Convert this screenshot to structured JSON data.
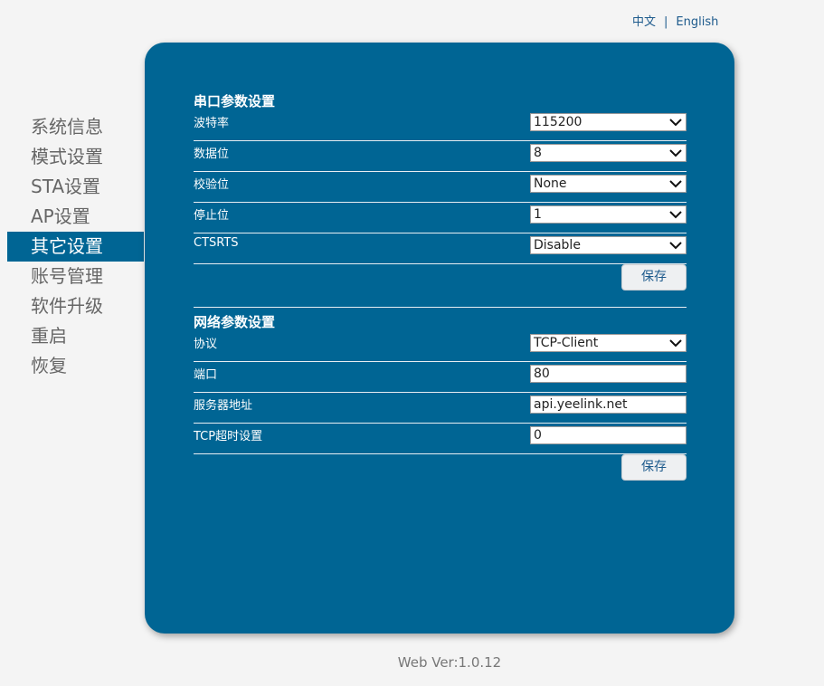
{
  "lang": {
    "zh": "中文",
    "sep": "|",
    "en": "English"
  },
  "sidebar": {
    "items": [
      {
        "label": "系统信息",
        "active": false
      },
      {
        "label": "模式设置",
        "active": false
      },
      {
        "label": "STA设置",
        "active": false
      },
      {
        "label": "AP设置",
        "active": false
      },
      {
        "label": "其它设置",
        "active": true
      },
      {
        "label": "账号管理",
        "active": false
      },
      {
        "label": "软件升级",
        "active": false
      },
      {
        "label": "重启",
        "active": false
      },
      {
        "label": "恢复",
        "active": false
      }
    ]
  },
  "serial": {
    "title": "串口参数设置",
    "baud_label": "波特率",
    "baud_value": "115200",
    "databits_label": "数据位",
    "databits_value": "8",
    "parity_label": "校验位",
    "parity_value": "None",
    "stopbits_label": "停止位",
    "stopbits_value": "1",
    "ctsrts_label": "CTSRTS",
    "ctsrts_value": "Disable",
    "save_label": "保存"
  },
  "network": {
    "title": "网络参数设置",
    "protocol_label": "协议",
    "protocol_value": "TCP-Client",
    "port_label": "端口",
    "port_value": "80",
    "server_label": "服务器地址",
    "server_value": "api.yeelink.net",
    "timeout_label": "TCP超时设置",
    "timeout_value": "0",
    "save_label": "保存"
  },
  "footer": {
    "version": "Web Ver:1.0.12"
  },
  "colors": {
    "panel": "#006594",
    "link": "#1d5a8c",
    "background": "#f4f4f4"
  }
}
